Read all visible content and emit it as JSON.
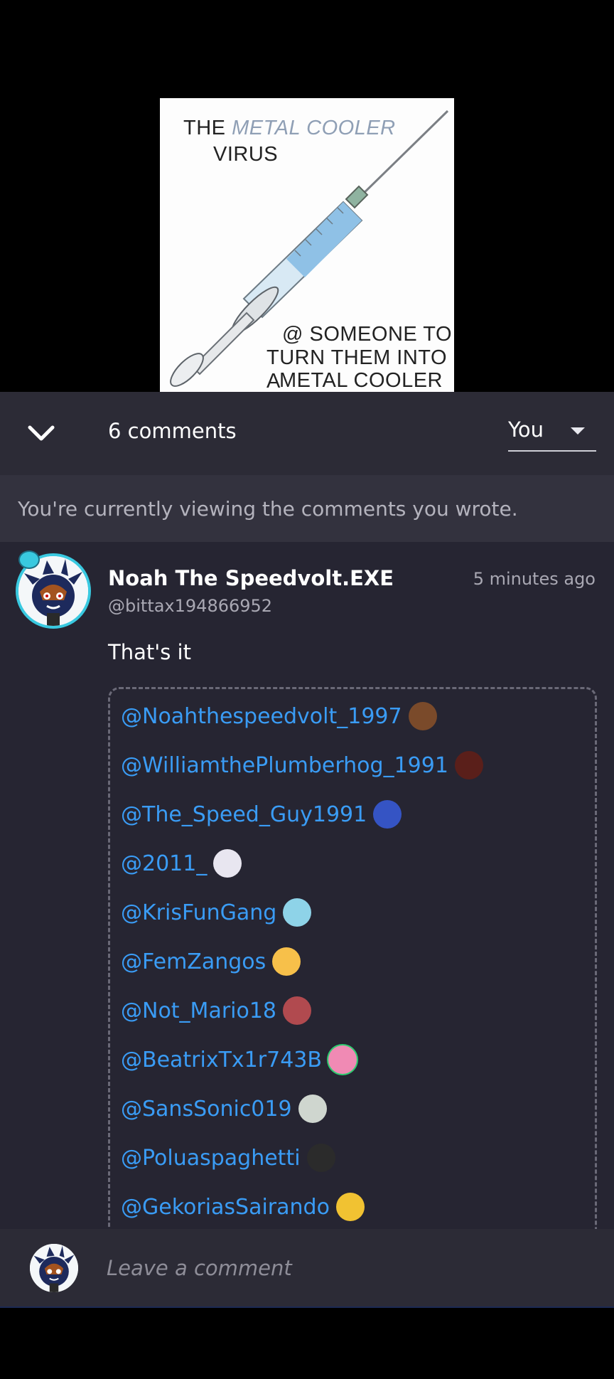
{
  "post": {
    "meme": {
      "top_prefix": "THE",
      "top_highlight": "METAL COOLER",
      "top_line2": "VIRUS",
      "bottom_line1": "@ SOMEONE TO",
      "bottom_line2": "TURN THEM INTO A",
      "bottom_highlight": "METAL COOLER"
    }
  },
  "comments_header": {
    "collapse_icon": "chevron-down-icon",
    "count_label": "6 comments",
    "filter_value": "You",
    "filter_icon": "caret-down-icon"
  },
  "info_banner": {
    "text": "You're currently viewing the comments you wrote."
  },
  "comment": {
    "author_name": "Noah The Speedvolt.EXE",
    "author_handle": "@bittax194866952",
    "timestamp": "5 minutes ago",
    "text": "That's it",
    "mentions": [
      {
        "handle": "@Noahthespeedvolt_1997",
        "avatar_color": "#7a4a2a"
      },
      {
        "handle": "@WilliamthePlumberhog_1991",
        "avatar_color": "#5a1f1a"
      },
      {
        "handle": "@The_Speed_Guy1991",
        "avatar_color": "#3554c4"
      },
      {
        "handle": "@2011_",
        "avatar_color": "#e8e6f0"
      },
      {
        "handle": "@KrisFunGang",
        "avatar_color": "#8ed3e8"
      },
      {
        "handle": "@FemZangos",
        "avatar_color": "#f7c04a"
      },
      {
        "handle": "@Not_Mario18",
        "avatar_color": "#b14a4f"
      },
      {
        "handle": "@BeatrixTx1r743B",
        "avatar_color": "#f08ab4"
      },
      {
        "handle": "@SansSonic019",
        "avatar_color": "#cfd6cf"
      },
      {
        "handle": "@Poluaspaghetti",
        "avatar_color": "#2b2b2b"
      },
      {
        "handle": "@GekoriasSairando",
        "avatar_color": "#f1c232"
      }
    ]
  },
  "comment_input": {
    "placeholder": "Leave a comment"
  },
  "colors": {
    "accent_cyan": "#39c9e0",
    "mention_blue": "#3a9cf5",
    "header_bg": "#2c2b36",
    "comment_bg": "#262532"
  }
}
